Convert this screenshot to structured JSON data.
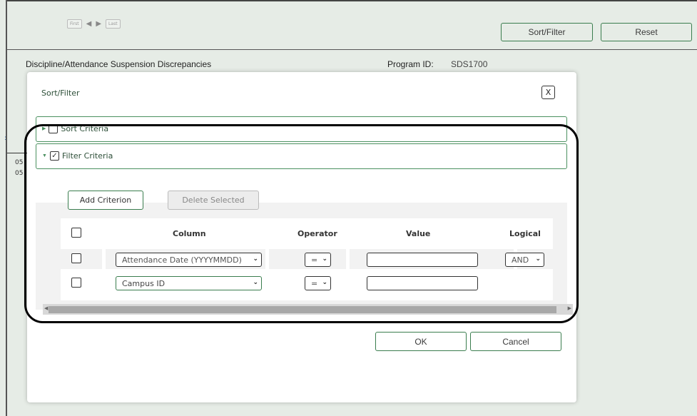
{
  "pager": {
    "first_label": "First",
    "prev_icon": "triangle-left",
    "next_icon": "triangle-right",
    "last_label": "Last"
  },
  "toolbar": {
    "sort_filter_label": "Sort/Filter",
    "reset_label": "Reset"
  },
  "page": {
    "title": "Discipline/Attendance Suspension Discrepancies",
    "program_id_label": "Program ID:",
    "program_id_value": "SDS1700"
  },
  "background_fragments": {
    "row1": "05",
    "row2": "05",
    "mark1": ":",
    "mark2": "I"
  },
  "modal": {
    "title": "Sort/Filter",
    "close_label": "X",
    "sort_section": {
      "label": "Sort Criteria",
      "checked": false,
      "expanded": false
    },
    "filter_section": {
      "label": "Filter Criteria",
      "checked": true,
      "expanded": true,
      "check_mark": "✓"
    },
    "add_criterion_label": "Add Criterion",
    "delete_selected_label": "Delete Selected",
    "columns": {
      "column": "Column",
      "operator": "Operator",
      "value": "Value",
      "logical": "Logical"
    },
    "rows": [
      {
        "column": "Attendance Date (YYYYMMDD)",
        "operator": "=",
        "value": "",
        "logical": "AND"
      },
      {
        "column": "Campus ID",
        "operator": "=",
        "value": "",
        "logical": ""
      }
    ],
    "ok_label": "OK",
    "cancel_label": "Cancel"
  },
  "colors": {
    "accent_green": "#3a7d4e",
    "background": "#e6ece6",
    "annotation": "#000000"
  }
}
